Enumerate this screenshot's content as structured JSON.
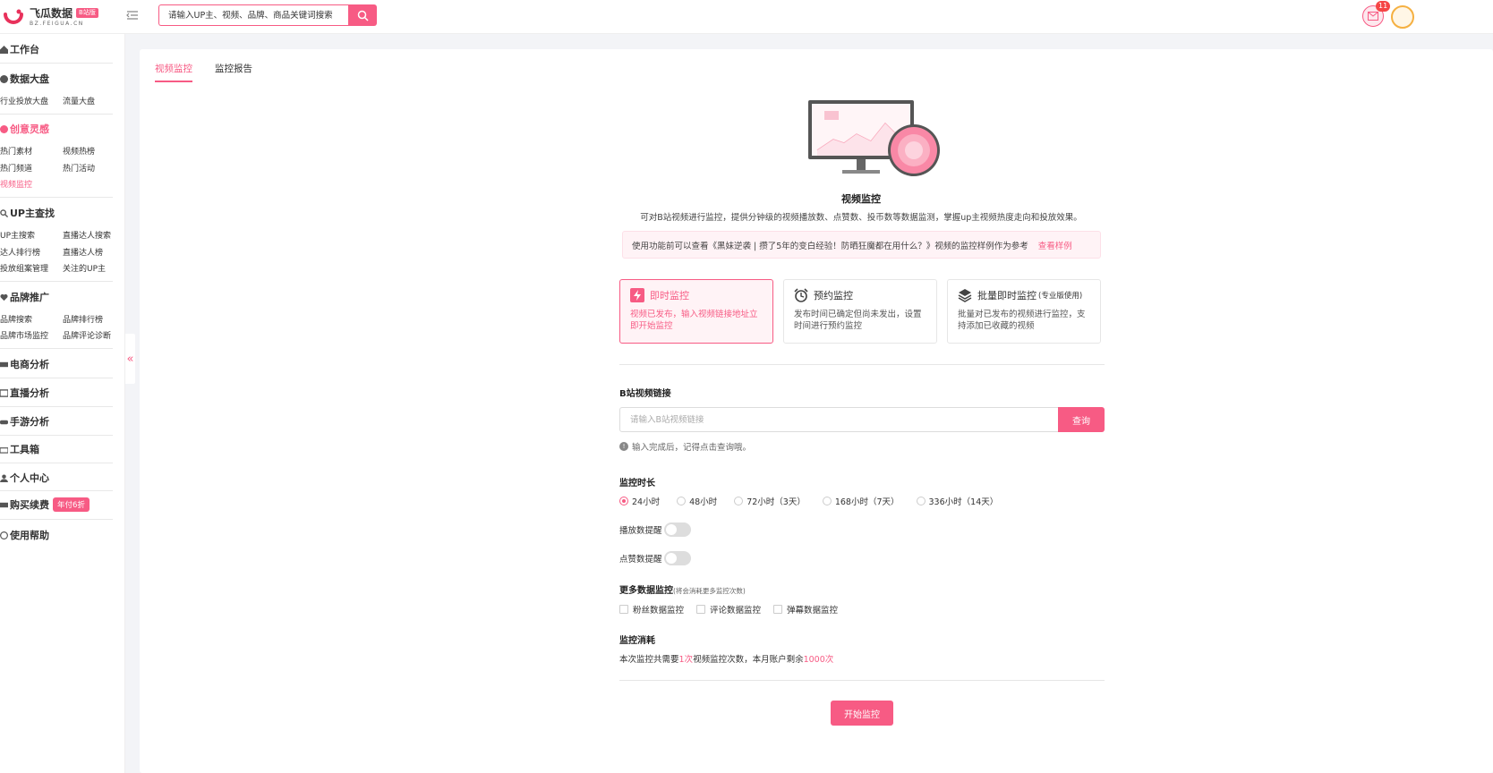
{
  "header": {
    "logo_name": "飞瓜数据",
    "logo_badge": "B站版",
    "logo_sub": "BZ.FEIGUA.CN",
    "search_placeholder": "请输入UP主、视频、品牌、商品关键词搜索",
    "mail_count": "11"
  },
  "sidebar": {
    "workbench": "工作台",
    "dashboard": {
      "title": "数据大盘",
      "items": [
        "行业投放大盘",
        "流量大盘"
      ]
    },
    "creative": {
      "title": "创意灵感",
      "items": [
        "热门素材",
        "视频热榜",
        "热门频道",
        "热门活动",
        "视频监控"
      ]
    },
    "up": {
      "title": "UP主查找",
      "items": [
        "UP主搜索",
        "直播达人搜索",
        "达人排行榜",
        "直播达人榜",
        "投放组案管理",
        "关注的UP主"
      ]
    },
    "brand": {
      "title": "品牌推广",
      "items": [
        "品牌搜索",
        "品牌排行榜",
        "品牌市场监控",
        "品牌评论诊断"
      ]
    },
    "ecommerce": "电商分析",
    "live": "直播分析",
    "games": "手游分析",
    "tools": "工具箱",
    "personal": "个人中心",
    "purchase": "购买续费",
    "purchase_badge": "年付6折",
    "help": "使用帮助",
    "collapse": "«"
  },
  "tabs": [
    "视频监控",
    "监控报告"
  ],
  "main": {
    "title": "视频监控",
    "description": "可对B站视频进行监控，提供分钟级的视频播放数、点赞数、投币数等数据监测，掌握up主视频热度走向和投放效果。",
    "notice": "使用功能前可以查看《黑妹逆袭 | 攒了5年的变白经验！防晒狂魔都在用什么？》视频的监控样例作为参考",
    "notice_link": "查看样例",
    "modes": [
      {
        "title": "即时监控",
        "tag": "",
        "desc": "视频已发布，输入视频链接地址立即开始监控"
      },
      {
        "title": "预约监控",
        "tag": "",
        "desc": "发布时间已确定但尚未发出，设置时间进行预约监控"
      },
      {
        "title": "批量即时监控",
        "tag": "(专业版使用)",
        "desc": "批量对已发布的视频进行监控，支持添加已收藏的视频"
      }
    ],
    "link_label": "B站视频链接",
    "link_placeholder": "请输入B站视频链接",
    "query_button": "查询",
    "hint": "输入完成后，记得点击查询哦。",
    "duration_label": "监控时长",
    "durations": [
      "24小时",
      "48小时",
      "72小时（3天）",
      "168小时（7天）",
      "336小时（14天）"
    ],
    "play_alert": "播放数提醒",
    "like_alert": "点赞数提醒",
    "more_label": "更多数据监控",
    "more_note": "(将会消耗更多监控次数)",
    "more_options": [
      "粉丝数据监控",
      "评论数据监控",
      "弹幕数据监控"
    ],
    "cost_label": "监控消耗",
    "cost_prefix": "本次监控共需要",
    "cost_times": "1次",
    "cost_middle": "视频监控次数，本月账户剩余",
    "cost_remaining": "1000次",
    "start_button": "开始监控"
  },
  "colors": {
    "accent": "#f75b84",
    "accent_light": "#fff3f6"
  }
}
